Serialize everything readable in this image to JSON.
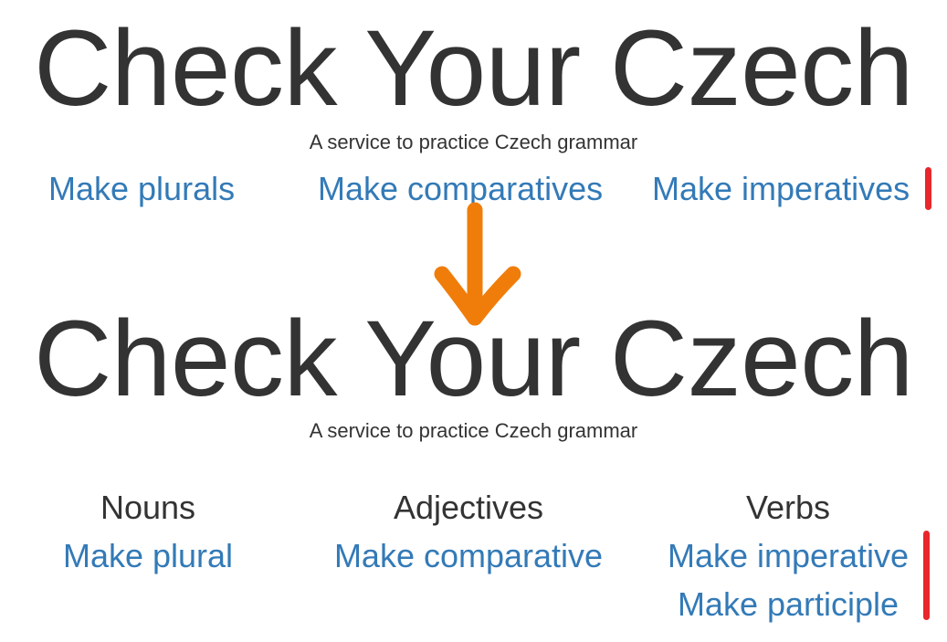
{
  "before": {
    "title": "Check Your Czech",
    "subtitle": "A service to practice Czech grammar",
    "links": [
      "Make plurals",
      "Make comparatives",
      "Make imperatives"
    ]
  },
  "after": {
    "title": "Check Your Czech",
    "subtitle": "A service to practice Czech grammar",
    "columns": [
      {
        "heading": "Nouns",
        "links": [
          "Make plural"
        ]
      },
      {
        "heading": "Adjectives",
        "links": [
          "Make comparative"
        ]
      },
      {
        "heading": "Verbs",
        "links": [
          "Make imperative",
          "Make participle"
        ]
      }
    ]
  },
  "annotation": {
    "arrow_icon": "arrow-down-icon",
    "arrow_color": "#f07d0a",
    "marker_color": "#e8262c"
  },
  "colors": {
    "text": "#333333",
    "link": "#337ab7"
  }
}
